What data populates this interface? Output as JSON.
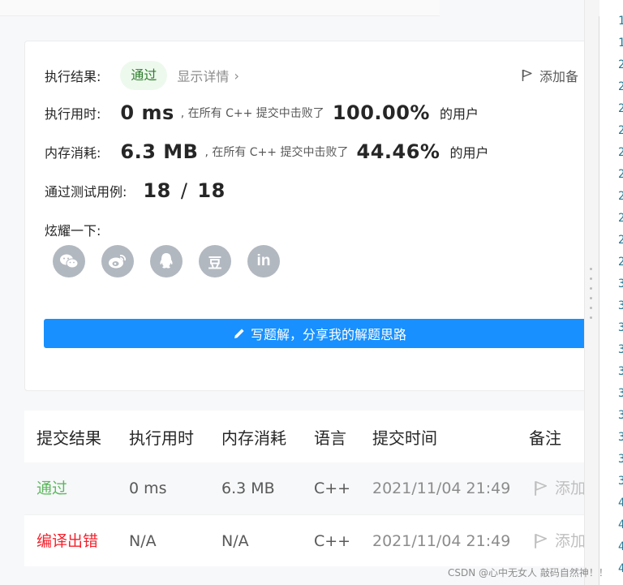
{
  "result": {
    "label": "执行结果:",
    "status": "通过",
    "detail_link": "显示详情",
    "add_note": "添加备",
    "runtime_label": "执行用时:",
    "runtime_value": "0 ms",
    "runtime_mid": ", 在所有 C++ 提交中击败了",
    "runtime_pct": "100.00%",
    "runtime_suffix": "的用户",
    "memory_label": "内存消耗:",
    "memory_value": "6.3 MB",
    "memory_mid": ", 在所有 C++ 提交中击败了",
    "memory_pct": "44.46%",
    "memory_suffix": "的用户",
    "tests_label": "通过测试用例:",
    "tests_passed": "18",
    "tests_sep": "/",
    "tests_total": "18",
    "share_label": "炫耀一下:",
    "share_icons": [
      "wechat-icon",
      "weibo-icon",
      "qq-icon",
      "douban-icon",
      "linkedin-icon"
    ],
    "douban_glyph": "豆",
    "linkedin_glyph": "in",
    "write_button": "写题解，分享我的解题思路"
  },
  "table": {
    "headers": [
      "提交结果",
      "执行用时",
      "内存消耗",
      "语言",
      "提交时间",
      "备注"
    ],
    "rows": [
      {
        "status": "通过",
        "runtime": "0 ms",
        "memory": "6.3 MB",
        "lang": "C++",
        "time": "2021/11/04 21:49",
        "note": "添加"
      },
      {
        "status": "编译出错",
        "runtime": "N/A",
        "memory": "N/A",
        "lang": "C++",
        "time": "2021/11/04 21:49",
        "note": "添加"
      }
    ]
  },
  "line_numbers": [
    "1",
    "1",
    "2",
    "2",
    "2",
    "2",
    "2",
    "2",
    "2",
    "2",
    "2",
    "2",
    "3",
    "3",
    "3",
    "3",
    "3",
    "3",
    "3",
    "3",
    "3",
    "3",
    "4",
    "4",
    "4",
    "4"
  ],
  "colors": {
    "accent": "#1890ff",
    "pass": "#5cb85c",
    "error": "#f5222d"
  },
  "watermark": "CSDN @心中无女人 敲码自然神！！"
}
